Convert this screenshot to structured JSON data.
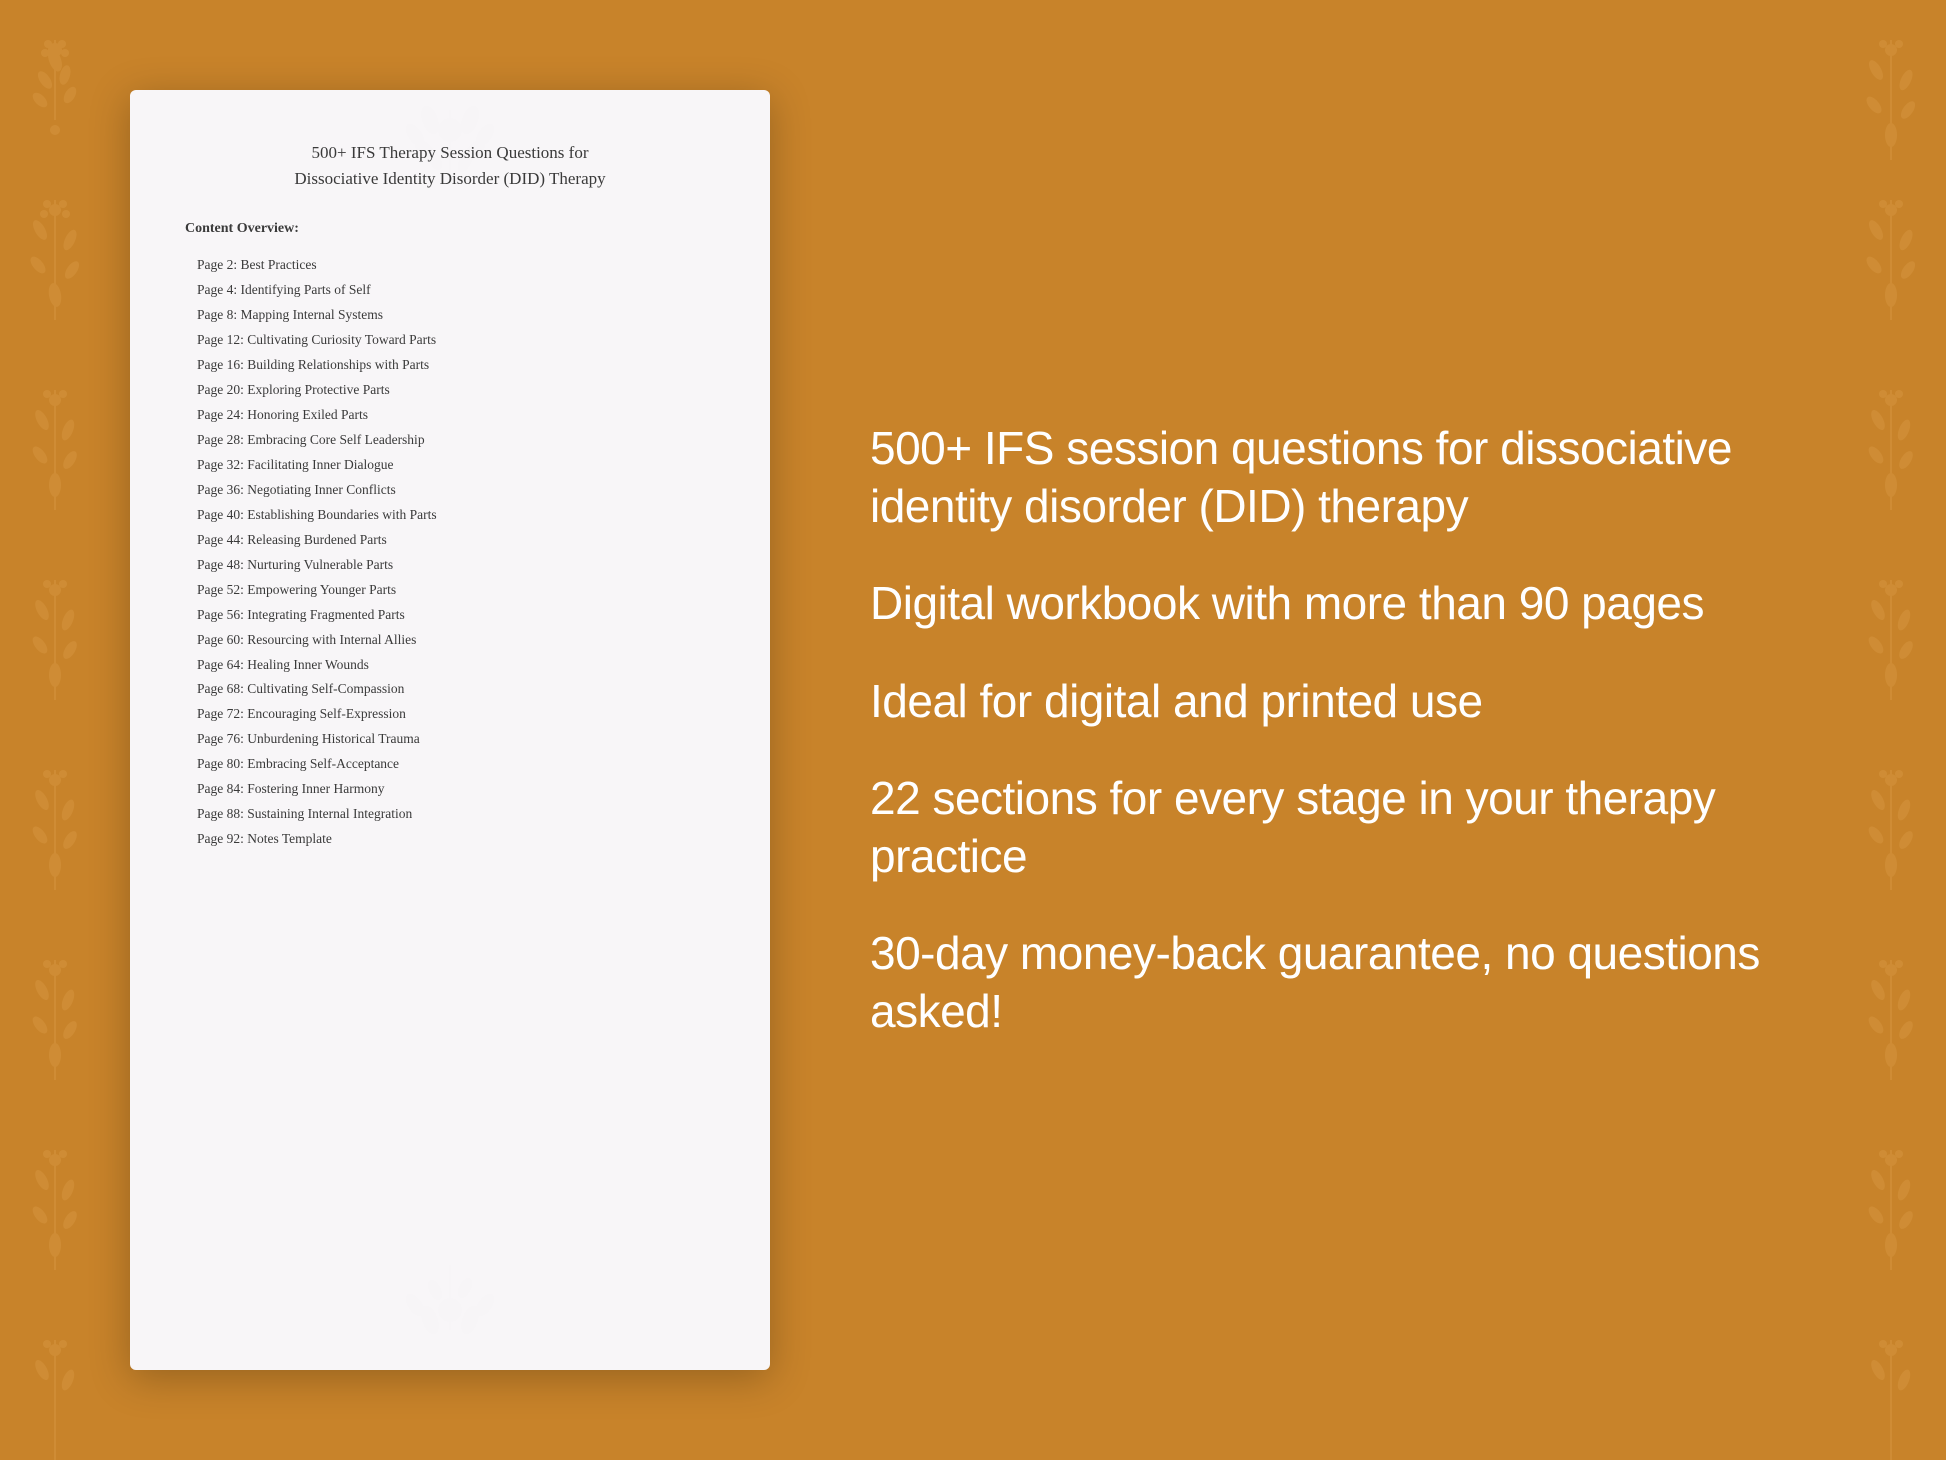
{
  "background_color": "#C8832A",
  "floral_icon": "❧",
  "document": {
    "title_line1": "500+ IFS Therapy Session Questions for",
    "title_line2": "Dissociative Identity Disorder (DID) Therapy",
    "content_label": "Content Overview:",
    "toc": [
      {
        "page": "Page  2:",
        "title": "Best Practices"
      },
      {
        "page": "Page  4:",
        "title": "Identifying Parts of Self"
      },
      {
        "page": "Page  8:",
        "title": "Mapping Internal Systems"
      },
      {
        "page": "Page 12:",
        "title": "Cultivating Curiosity Toward Parts"
      },
      {
        "page": "Page 16:",
        "title": "Building Relationships with Parts"
      },
      {
        "page": "Page 20:",
        "title": "Exploring Protective Parts"
      },
      {
        "page": "Page 24:",
        "title": "Honoring Exiled Parts"
      },
      {
        "page": "Page 28:",
        "title": "Embracing Core Self Leadership"
      },
      {
        "page": "Page 32:",
        "title": "Facilitating Inner Dialogue"
      },
      {
        "page": "Page 36:",
        "title": "Negotiating Inner Conflicts"
      },
      {
        "page": "Page 40:",
        "title": "Establishing Boundaries with Parts"
      },
      {
        "page": "Page 44:",
        "title": "Releasing Burdened Parts"
      },
      {
        "page": "Page 48:",
        "title": "Nurturing Vulnerable Parts"
      },
      {
        "page": "Page 52:",
        "title": "Empowering Younger Parts"
      },
      {
        "page": "Page 56:",
        "title": "Integrating Fragmented Parts"
      },
      {
        "page": "Page 60:",
        "title": "Resourcing with Internal Allies"
      },
      {
        "page": "Page 64:",
        "title": "Healing Inner Wounds"
      },
      {
        "page": "Page 68:",
        "title": "Cultivating Self-Compassion"
      },
      {
        "page": "Page 72:",
        "title": "Encouraging Self-Expression"
      },
      {
        "page": "Page 76:",
        "title": "Unburdening Historical Trauma"
      },
      {
        "page": "Page 80:",
        "title": "Embracing Self-Acceptance"
      },
      {
        "page": "Page 84:",
        "title": "Fostering Inner Harmony"
      },
      {
        "page": "Page 88:",
        "title": "Sustaining Internal Integration"
      },
      {
        "page": "Page 92:",
        "title": "Notes Template"
      }
    ]
  },
  "features": [
    {
      "id": "feature-1",
      "text": "500+ IFS session questions for dissociative identity disorder (DID) therapy"
    },
    {
      "id": "feature-2",
      "text": "Digital workbook with more than 90 pages"
    },
    {
      "id": "feature-3",
      "text": "Ideal for digital and printed use"
    },
    {
      "id": "feature-4",
      "text": "22 sections for every stage in your therapy practice"
    },
    {
      "id": "feature-5",
      "text": "30-day money-back guarantee, no questions asked!"
    }
  ]
}
